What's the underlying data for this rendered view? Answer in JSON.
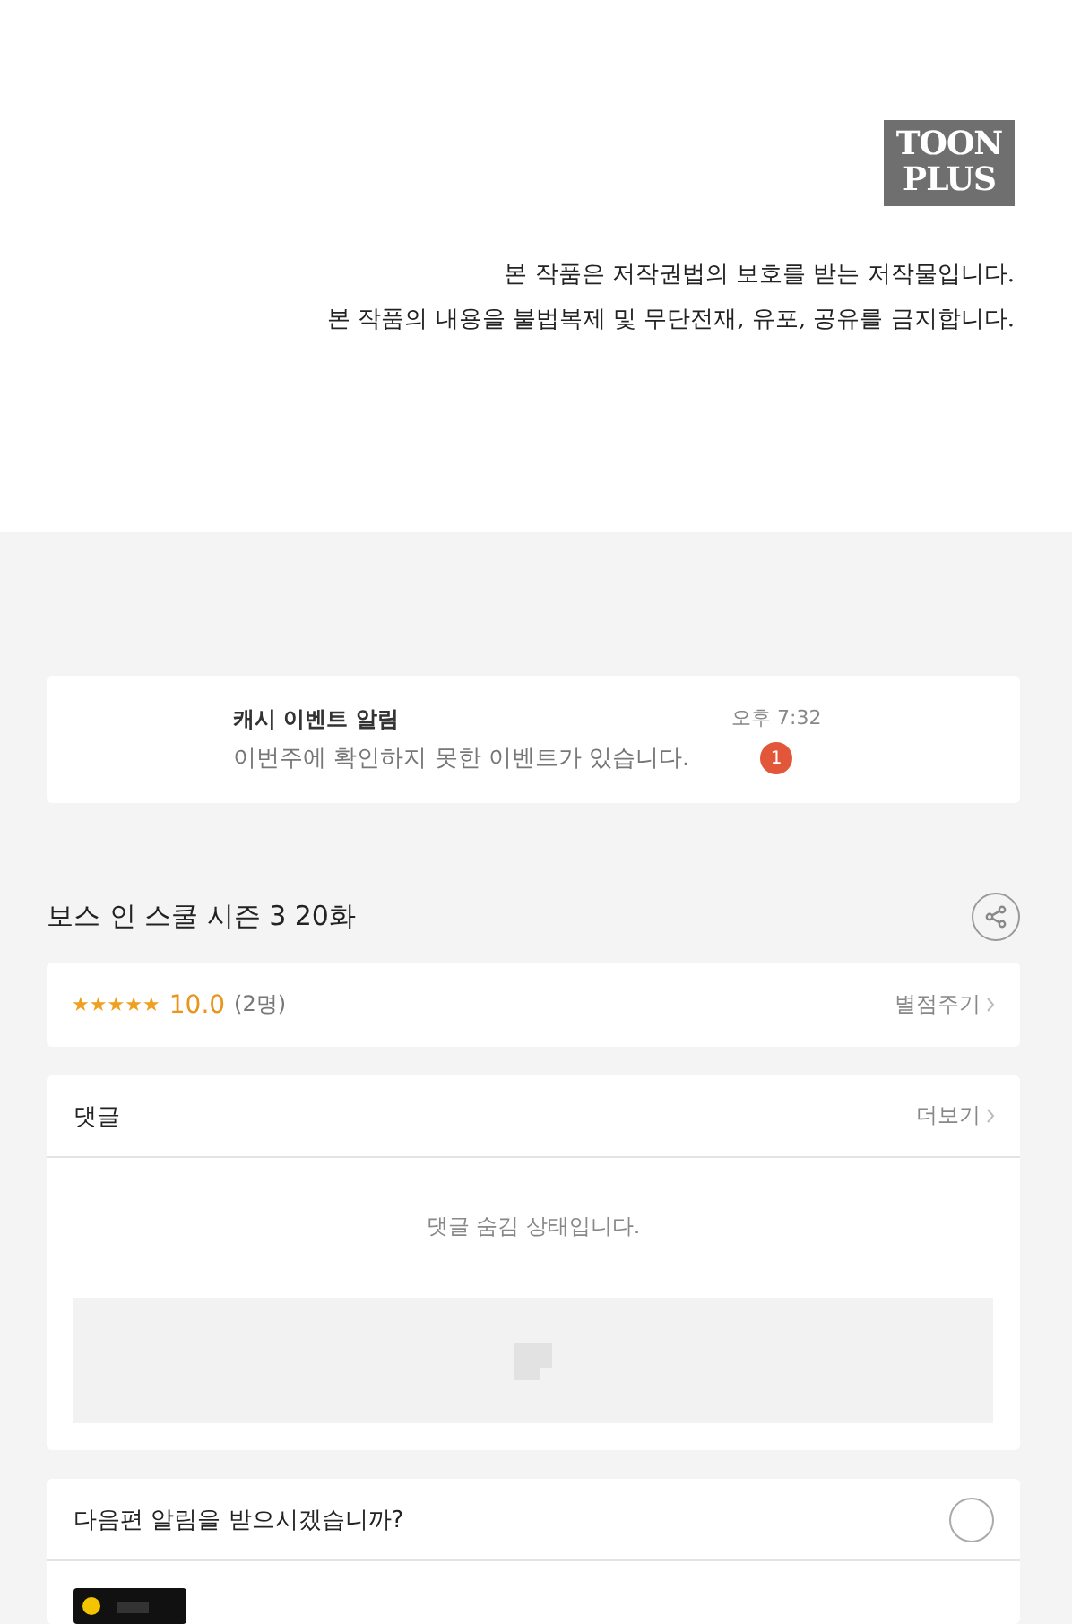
{
  "logo": {
    "lines": [
      "TOON",
      "PLUS"
    ]
  },
  "notice": [
    "본 작품은 저작권법의 보호를 받는 저작물입니다.",
    "본 작품의 내용을 불법복제 및 무단전재, 유포, 공유를 금지합니다."
  ],
  "push": {
    "title": "캐시 이벤트 알림",
    "message": "이번주에 확인하지 못한 이벤트가 있습니다.",
    "time": "오후 7:32",
    "badge": "1"
  },
  "episode": {
    "title": "보스 인 스쿨 시즌 3 20화"
  },
  "rating": {
    "stars": 5,
    "score": "10.0",
    "count": "(2명)",
    "action": "별점주기"
  },
  "comments": {
    "title": "댓글",
    "more": "더보기",
    "status": "댓글 숨김 상태입니다."
  },
  "next": {
    "question": "다음편 알림을 받으시겠습니까?"
  }
}
